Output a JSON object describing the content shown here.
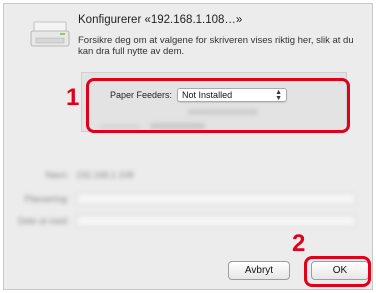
{
  "dialog": {
    "title": "Konfigurerer «192.168.1.108…»",
    "description": "Forsikre deg om at valgene for skriveren vises riktig her, slik at du kan dra full nytte av dem."
  },
  "paper_feeders": {
    "label": "Paper Feeders:",
    "value": "Not Installed"
  },
  "fields": {
    "name_label": "Navn:",
    "name_value": "192.168.1.108",
    "location_label": "Plassering:",
    "shared_label": "Dele ut med:"
  },
  "buttons": {
    "cancel": "Avbryt",
    "ok": "OK"
  },
  "annotations": {
    "step1": "1",
    "step2": "2",
    "color": "#e0001b"
  },
  "icons": {
    "printer": "printer-icon",
    "select_arrows": "select-updown-icon"
  }
}
